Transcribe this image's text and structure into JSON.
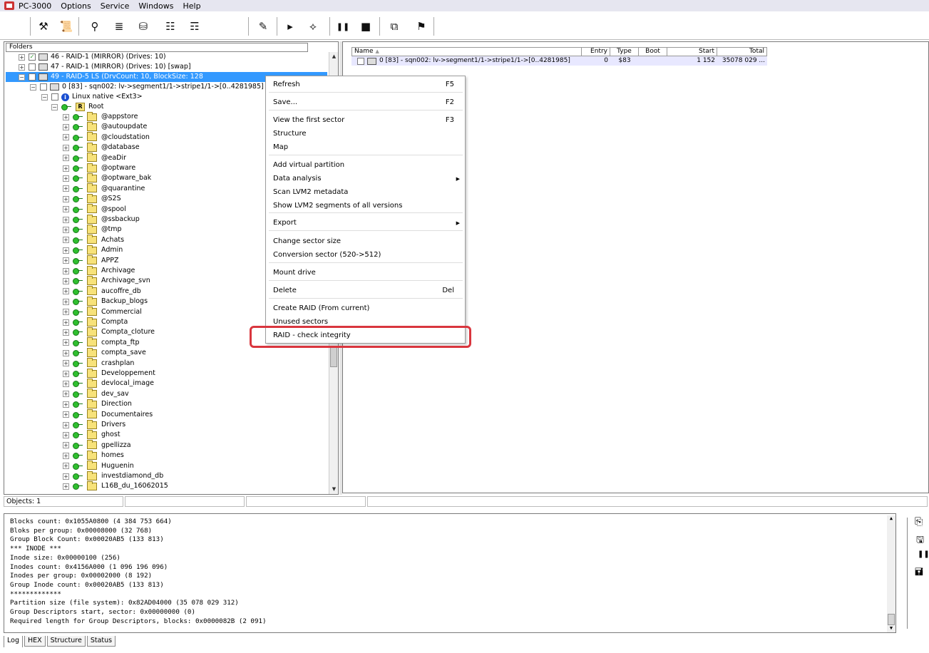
{
  "app": {
    "title": "PC-3000",
    "menu": [
      "Options",
      "Service",
      "Windows",
      "Help"
    ]
  },
  "toolbar": {
    "icons": [
      "tools-icon",
      "script-icon",
      "binoculars-icon",
      "stack-icon",
      "disk-icon",
      "tree-icon",
      "tree-disk-icon",
      "edit-icon",
      "play-icon",
      "route-icon",
      "pause-icon",
      "stop-icon",
      "copy-icon",
      "walk-icon"
    ]
  },
  "folders": {
    "header": "Folders",
    "raid46": "46 - RAID-1 (MIRROR) (Drives: 10)",
    "raid47": "47 - RAID-1 (MIRROR) (Drives: 10) [swap]",
    "raid49": "49 - RAID-5 LS (DrvCount: 10, BlockSize: 128",
    "partition": "0 [83] - sqn002: lv->segment1/1->stripe1/1->[0..4281985]",
    "fs": "Linux native <Ext3>",
    "root": "Root",
    "root_badge": "R",
    "items": [
      "@appstore",
      "@autoupdate",
      "@cloudstation",
      "@database",
      "@eaDir",
      "@optware",
      "@optware_bak",
      "@quarantine",
      "@S2S",
      "@spool",
      "@ssbackup",
      "@tmp",
      "Achats",
      "Admin",
      "APPZ",
      "Archivage",
      "Archivage_svn",
      "aucoffre_db",
      "Backup_blogs",
      "Commercial",
      "Compta",
      "Compta_cloture",
      "compta_ftp",
      "compta_save",
      "crashplan",
      "Developpement",
      "devlocal_image",
      "dev_sav",
      "Direction",
      "Documentaires",
      "Drivers",
      "ghost",
      "gpellizza",
      "homes",
      "Huguenin",
      "investdiamond_db",
      "L16B_du_16062015"
    ]
  },
  "grid": {
    "columns": [
      "Name",
      "Entry",
      "Type",
      "Boot",
      "Start",
      "Total"
    ],
    "rows": [
      {
        "name": "0 [83] - sqn002: lv->segment1/1->stripe1/1->[0..4281985]",
        "entry": "0",
        "type": "$83",
        "boot": "",
        "start": "1 152",
        "total": "35078 029 ..."
      }
    ]
  },
  "status": {
    "objects": "Objects: 1"
  },
  "context_menu": {
    "items": [
      {
        "label": "Refresh",
        "shortcut": "F5"
      },
      {
        "label": "Save...",
        "shortcut": "F2"
      },
      {
        "label": "View the first sector",
        "shortcut": "F3"
      },
      {
        "label": "Structure",
        "shortcut": ""
      },
      {
        "label": "Map",
        "shortcut": ""
      },
      {
        "label": "Add virtual partition",
        "shortcut": ""
      },
      {
        "label": "Data analysis",
        "shortcut": "",
        "submenu": true
      },
      {
        "label": "Scan LVM2 metadata",
        "shortcut": ""
      },
      {
        "label": "Show LVM2 segments of all versions",
        "shortcut": ""
      },
      {
        "label": "Export",
        "shortcut": "",
        "submenu": true
      },
      {
        "label": "Change sector size",
        "shortcut": ""
      },
      {
        "label": "Conversion sector (520->512)",
        "shortcut": ""
      },
      {
        "label": "Mount drive",
        "shortcut": ""
      },
      {
        "label": "Delete",
        "shortcut": "Del"
      },
      {
        "label": "Create RAID (From current)",
        "shortcut": ""
      },
      {
        "label": "Unused sectors",
        "shortcut": ""
      },
      {
        "label": "RAID - check integrity",
        "shortcut": ""
      }
    ]
  },
  "log": {
    "lines": [
      "Blocks count: 0x1055A0800 (4 384 753 664)",
      "Bloks per group: 0x00008000 (32 768)",
      "Group Block Count: 0x00020AB5 (133 813)",
      "*** INODE ***",
      "Inode size: 0x00000100 (256)",
      "Inodes count: 0x4156A000 (1 096 196 096)",
      "Inodes per group: 0x00002000 (8 192)",
      "Group Inode count: 0x00020AB5 (133 813)",
      "*************",
      "Partition size (file system): 0x82AD04000 (35 078 029 312)",
      "Group Descriptors start, sector: 0x00000000 (0)",
      "Required length for Group Descriptors, blocks: 0x0000082B (2 091)"
    ]
  },
  "tabs": [
    "Log",
    "HEX",
    "Structure",
    "Status"
  ],
  "colors": {
    "selection": "#3399ff",
    "highlight": "#d9363e"
  }
}
